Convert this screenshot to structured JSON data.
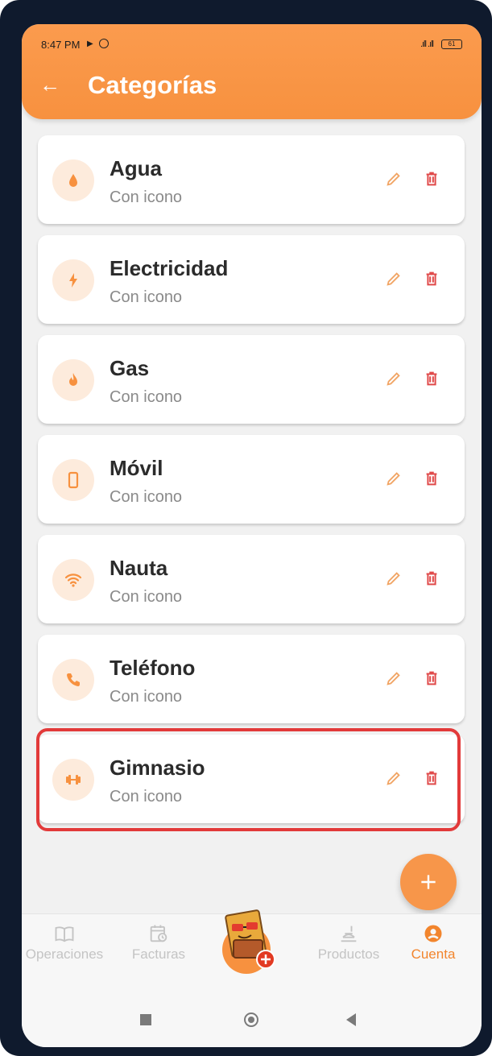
{
  "status_bar": {
    "time": "8:47 PM",
    "battery": "61"
  },
  "header": {
    "back_icon": "arrow-left-icon",
    "title": "Categorías"
  },
  "categories": [
    {
      "name": "Agua",
      "subtitle": "Con icono",
      "icon": "water-drop-icon"
    },
    {
      "name": "Electricidad",
      "subtitle": "Con icono",
      "icon": "lightning-icon"
    },
    {
      "name": "Gas",
      "subtitle": "Con icono",
      "icon": "flame-icon"
    },
    {
      "name": "Móvil",
      "subtitle": "Con icono",
      "icon": "mobile-phone-icon"
    },
    {
      "name": "Nauta",
      "subtitle": "Con icono",
      "icon": "wifi-icon"
    },
    {
      "name": "Teléfono",
      "subtitle": "Con icono",
      "icon": "phone-icon"
    },
    {
      "name": "Gimnasio",
      "subtitle": "Con icono",
      "icon": "dumbbell-icon"
    }
  ],
  "actions": {
    "edit_icon": "pencil-icon",
    "delete_icon": "trash-icon"
  },
  "fab": {
    "icon": "plus-icon"
  },
  "bottom_nav": {
    "items": [
      {
        "label": "Operaciones",
        "icon": "book-icon"
      },
      {
        "label": "Facturas",
        "icon": "calendar-clock-icon"
      },
      {
        "label": "Productos",
        "icon": "receipt-icon"
      },
      {
        "label": "Cuenta",
        "icon": "account-circle-icon"
      }
    ],
    "active": "Cuenta"
  },
  "colors": {
    "accent": "#f7913f",
    "delete": "#e04a4a",
    "highlight_border": "#e23a3a",
    "icon_bg": "#fdebdc"
  }
}
